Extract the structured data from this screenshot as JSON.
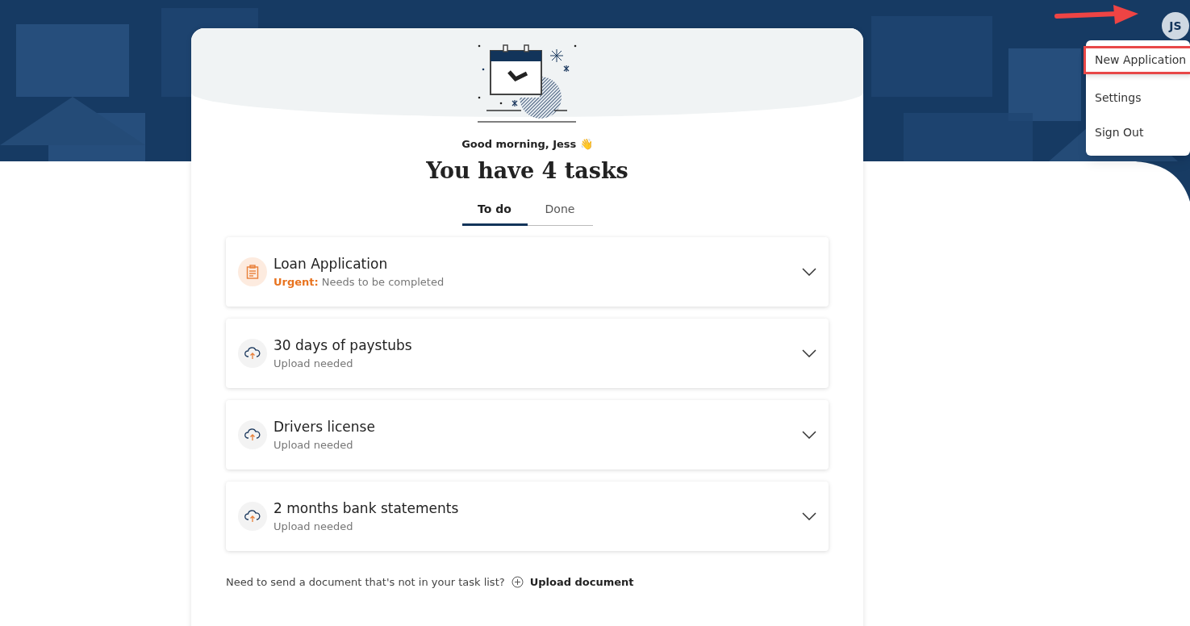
{
  "user_menu": {
    "avatar": "JS",
    "items": [
      {
        "label": "New Application",
        "highlighted": true
      },
      {
        "label": "Settings",
        "highlighted": false
      },
      {
        "label": "Sign Out",
        "highlighted": false
      }
    ]
  },
  "greeting": "Good morning, Jess 👋",
  "heading": "You have 4 tasks",
  "tabs": [
    {
      "label": "To do",
      "selected": true
    },
    {
      "label": "Done",
      "selected": false
    }
  ],
  "tasks": [
    {
      "kind": "form",
      "title": "Loan Application",
      "flag": "Urgent:",
      "status": "Needs to be completed"
    },
    {
      "kind": "upload",
      "title": "30 days of paystubs",
      "status": "Upload needed"
    },
    {
      "kind": "upload",
      "title": "Drivers license",
      "status": "Upload needed"
    },
    {
      "kind": "upload",
      "title": "2 months bank statements",
      "status": "Upload needed"
    }
  ],
  "footer": {
    "question": "Need to send a document that's not in your task list?",
    "link": "Upload document"
  }
}
